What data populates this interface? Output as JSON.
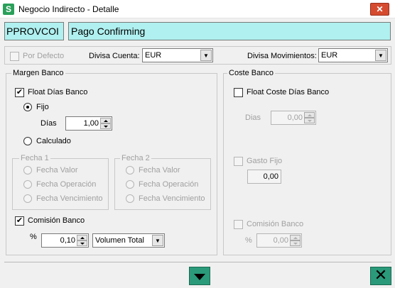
{
  "window": {
    "title": "Negocio Indirecto - Detalle",
    "app_icon_glyph": "S",
    "close_glyph": "✕"
  },
  "header": {
    "code": "PPROVCOI",
    "name": "Pago Confirming"
  },
  "options": {
    "por_defecto_label": "Por Defecto",
    "divisa_cuenta_label": "Divisa Cuenta:",
    "divisa_cuenta_value": "EUR",
    "divisa_movimientos_label": "Divisa Movimientos:",
    "divisa_movimientos_value": "EUR"
  },
  "margen_banco": {
    "title": "Margen Banco",
    "float_dias_label": "Float Días Banco",
    "float_dias_checked": true,
    "fijo_label": "Fijo",
    "dias_label": "Días",
    "dias_value": "1,00",
    "calculado_label": "Calculado",
    "fecha1": {
      "title": "Fecha 1",
      "options": [
        "Fecha Valor",
        "Fecha Operación",
        "Fecha Vencimiento"
      ]
    },
    "fecha2": {
      "title": "Fecha 2",
      "options": [
        "Fecha Valor",
        "Fecha Operación",
        "Fecha Vencimiento"
      ]
    },
    "comision_label": "Comisión Banco",
    "comision_checked": true,
    "percent_label": "%",
    "comision_value": "0,10",
    "comision_base": "Volumen Total"
  },
  "coste_banco": {
    "title": "Coste Banco",
    "float_coste_label": "Float Coste Días Banco",
    "dias_label": "Dias",
    "dias_value": "0,00",
    "gasto_fijo_label": "Gasto Fijo",
    "gasto_fijo_value": "0,00",
    "comision_label": "Comisión Banco",
    "percent_label": "%",
    "comision_value": "0,00"
  },
  "footer": {
    "close_glyph": "✕"
  }
}
